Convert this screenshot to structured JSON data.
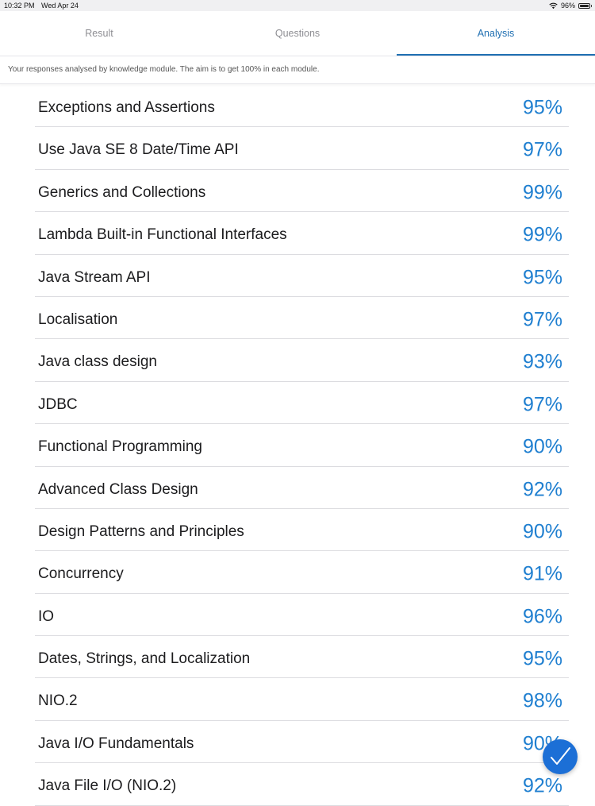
{
  "status_bar": {
    "time": "10:32 PM",
    "date": "Wed Apr 24",
    "battery": "96%",
    "wifi_icon": "wifi-icon",
    "battery_icon": "battery-icon"
  },
  "tabs": [
    {
      "label": "Result",
      "active": false
    },
    {
      "label": "Questions",
      "active": false
    },
    {
      "label": "Analysis",
      "active": true
    }
  ],
  "subtitle": "Your responses analysed by knowledge module. The aim is to get 100% in each module.",
  "modules": [
    {
      "name": "Exceptions and Assertions",
      "score": "95%"
    },
    {
      "name": "Use Java SE 8 Date/Time API",
      "score": "97%"
    },
    {
      "name": "Generics and Collections",
      "score": "99%"
    },
    {
      "name": "Lambda Built-in Functional Interfaces",
      "score": "99%"
    },
    {
      "name": "Java Stream API",
      "score": "95%"
    },
    {
      "name": "Localisation",
      "score": "97%"
    },
    {
      "name": "Java class design",
      "score": "93%"
    },
    {
      "name": "JDBC",
      "score": "97%"
    },
    {
      "name": "Functional Programming",
      "score": "90%"
    },
    {
      "name": "Advanced Class Design",
      "score": "92%"
    },
    {
      "name": "Design Patterns and Principles",
      "score": "90%"
    },
    {
      "name": "Concurrency",
      "score": "91%"
    },
    {
      "name": "IO",
      "score": "96%"
    },
    {
      "name": "Dates, Strings, and Localization",
      "score": "95%"
    },
    {
      "name": "NIO.2",
      "score": "98%"
    },
    {
      "name": "Java I/O Fundamentals",
      "score": "90%"
    },
    {
      "name": "Java File I/O (NIO.2)",
      "score": "92%"
    }
  ],
  "fab": {
    "icon": "checkmark-icon"
  },
  "colors": {
    "accent": "#1f6fb2",
    "score": "#1f7fd0",
    "fab": "#1c6fd6"
  }
}
